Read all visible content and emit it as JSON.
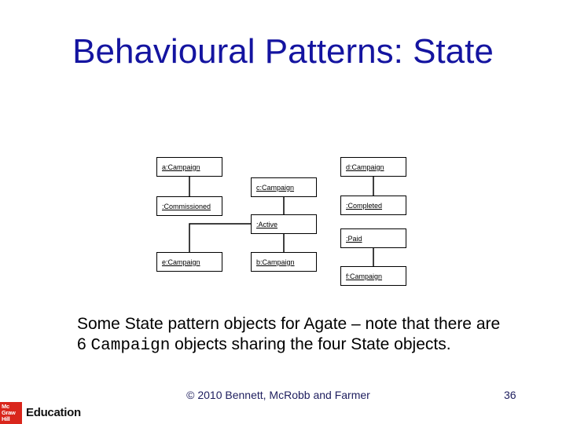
{
  "slide": {
    "title": "Behavioural Patterns: State",
    "page_number": "36",
    "copyright": "© 2010 Bennett, McRobb and Farmer",
    "logo": {
      "brand_lines": [
        "Mc",
        "Graw",
        "Hill"
      ],
      "label": "Education",
      "color": "#d9261c"
    },
    "title_color": "#1414a0"
  },
  "caption": {
    "part1": "Some State pattern objects for Agate – note that there are 6 ",
    "code": "Campaign",
    "part2": " objects sharing the four State objects."
  },
  "diagram": {
    "type": "UML object diagram",
    "objects": [
      {
        "id": "a",
        "label": "a:Campaign"
      },
      {
        "id": "commissioned",
        "label": ":Commissioned"
      },
      {
        "id": "c",
        "label": "c:Campaign"
      },
      {
        "id": "active",
        "label": ":Active"
      },
      {
        "id": "b",
        "label": "b:Campaign"
      },
      {
        "id": "e",
        "label": "e:Campaign"
      },
      {
        "id": "d",
        "label": "d:Campaign"
      },
      {
        "id": "completed",
        "label": ":Completed"
      },
      {
        "id": "paid",
        "label": ":Paid"
      },
      {
        "id": "f",
        "label": "f:Campaign"
      }
    ],
    "links": [
      [
        "a",
        "commissioned"
      ],
      [
        "c",
        "active"
      ],
      [
        "active",
        "b"
      ],
      [
        "active",
        "e"
      ],
      [
        "d",
        "completed"
      ],
      [
        "paid",
        "f"
      ]
    ]
  }
}
